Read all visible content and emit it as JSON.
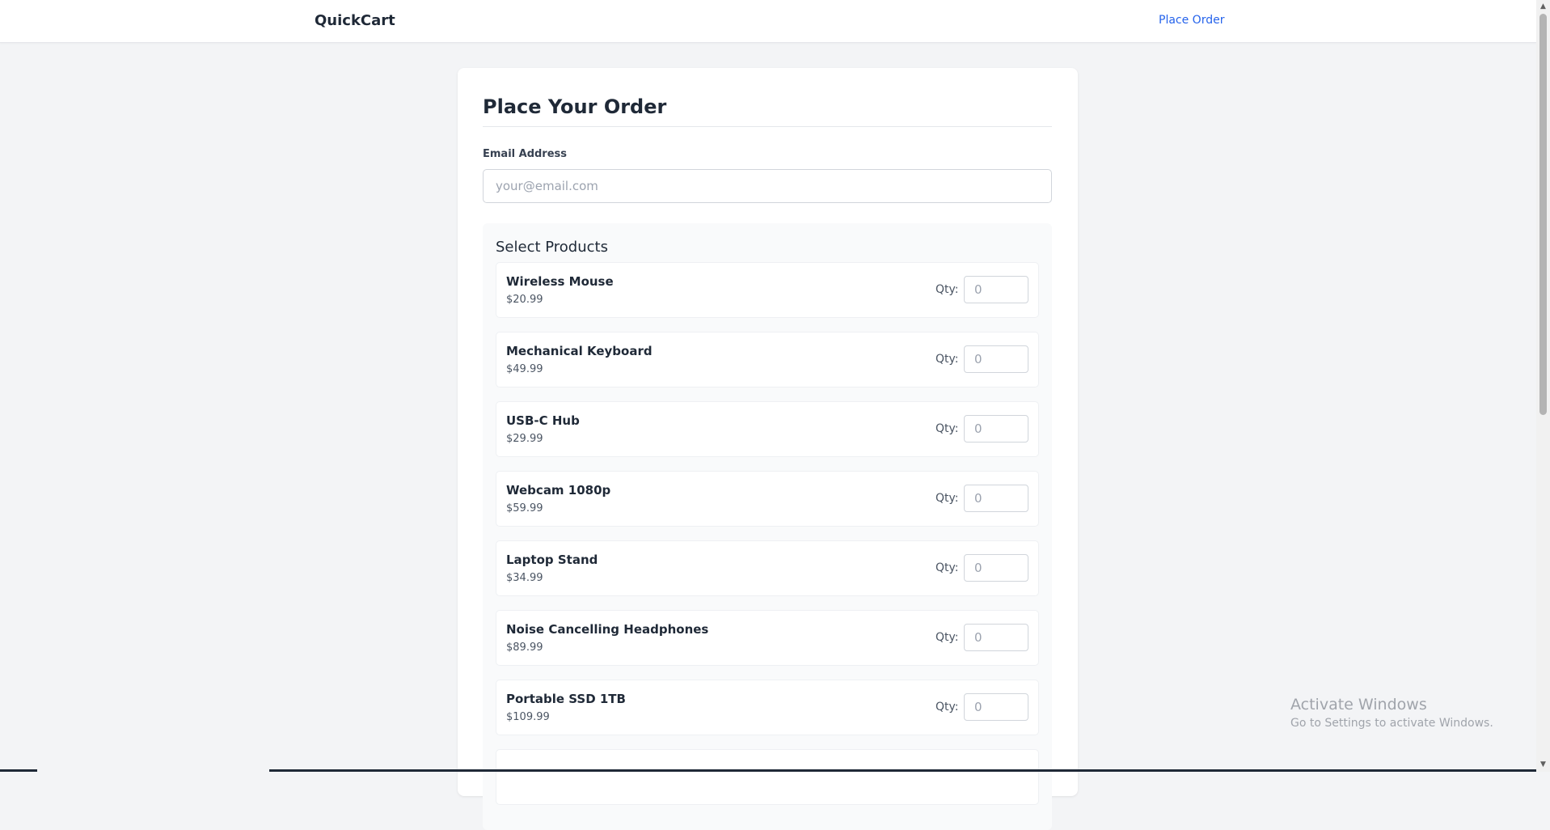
{
  "navbar": {
    "brand": "QuickCart",
    "link_label": "Place Order"
  },
  "form": {
    "title": "Place Your Order",
    "email_label": "Email Address",
    "email_placeholder": "your@email.com",
    "email_value": "",
    "products_title": "Select Products",
    "qty_label": "Qty:",
    "qty_placeholder": "0",
    "products": [
      {
        "name": "Wireless Mouse",
        "price": "$20.99"
      },
      {
        "name": "Mechanical Keyboard",
        "price": "$49.99"
      },
      {
        "name": "USB-C Hub",
        "price": "$29.99"
      },
      {
        "name": "Webcam 1080p",
        "price": "$59.99"
      },
      {
        "name": "Laptop Stand",
        "price": "$34.99"
      },
      {
        "name": "Noise Cancelling Headphones",
        "price": "$89.99"
      },
      {
        "name": "Portable SSD 1TB",
        "price": "$109.99"
      }
    ]
  },
  "watermark": {
    "title": "Activate Windows",
    "subtitle": "Go to Settings to activate Windows."
  },
  "colors": {
    "accent": "#2563eb",
    "background": "#f3f4f6"
  }
}
